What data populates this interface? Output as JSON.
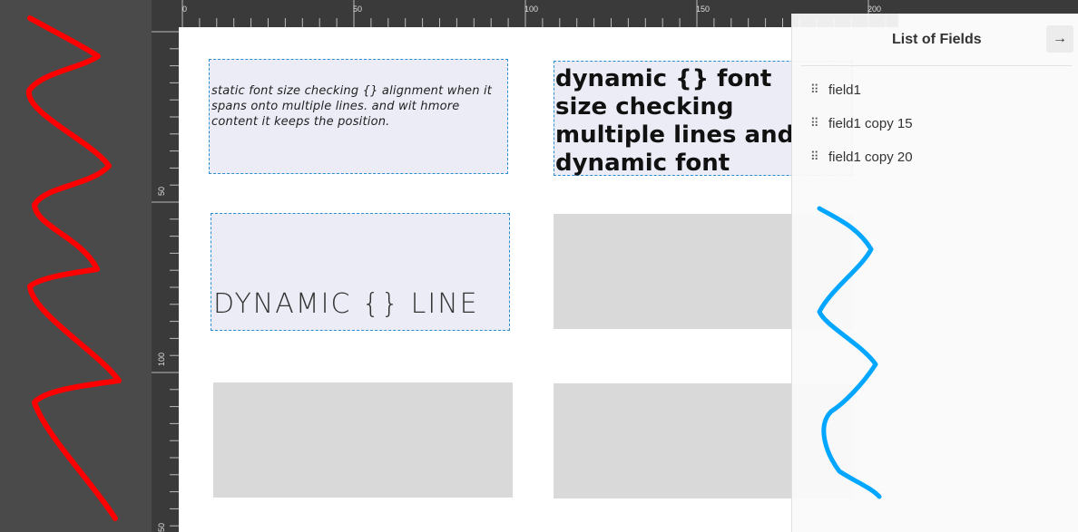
{
  "ruler": {
    "top_labels": [
      "0",
      "50",
      "100",
      "150",
      "200"
    ],
    "left_labels": [
      "50",
      "100",
      "50"
    ]
  },
  "canvas": {
    "static_field_text": "static font size checking {} alignment when it spans onto multiple lines. and wit hmore content it keeps the position.",
    "dynamic_field_text": "dynamic {} font size checking multiple lines and dynamic font",
    "dynamic_line_text": "DYNAMIC {} LINE"
  },
  "panel": {
    "title": "List of Fields",
    "close_icon": "arrow-right-icon",
    "fields": [
      "field1",
      "field1 copy 15",
      "field1 copy 20"
    ]
  },
  "colors": {
    "selection_border": "#2a8fd0",
    "red_scribble": "#ff0000",
    "blue_scribble": "#00a6ff"
  }
}
